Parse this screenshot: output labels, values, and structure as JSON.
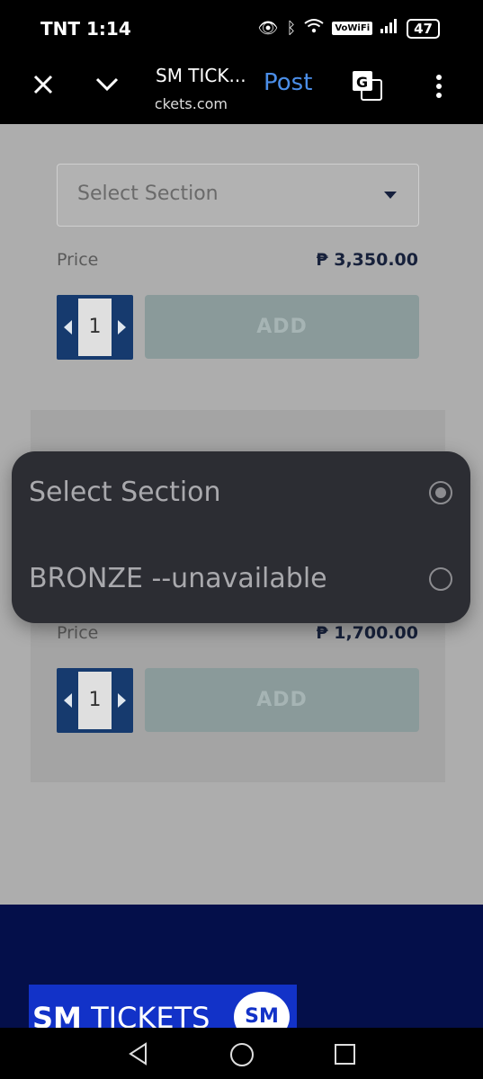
{
  "status_bar": {
    "time": "TNT 1:14",
    "network_badge": "VoWiFi",
    "battery": "47"
  },
  "toolbar": {
    "title": "SM TICK...",
    "url": "smtickets.com",
    "post_label": "Post"
  },
  "ticket_1": {
    "select_placeholder": "Select Section",
    "price_label": "Price",
    "price_value": "₱ 3,350.00",
    "quantity": "1",
    "add_label": "ADD"
  },
  "ticket_2": {
    "price_label": "Price",
    "price_value": "₱ 1,700.00",
    "quantity": "1",
    "add_label": "ADD"
  },
  "dropdown": {
    "options": [
      {
        "label": "Select Section",
        "selected": true
      },
      {
        "label": "BRONZE --unavailable",
        "selected": false
      }
    ]
  },
  "footer": {
    "logo_text_bold": "SM",
    "logo_text": " TICKETS",
    "logo_seal": "SM"
  },
  "colors": {
    "accent_blue": "#4b8ee8",
    "stepper": "#163a6e",
    "footer_bg": "#040f4a",
    "dropdown_bg": "#2c2d33"
  }
}
